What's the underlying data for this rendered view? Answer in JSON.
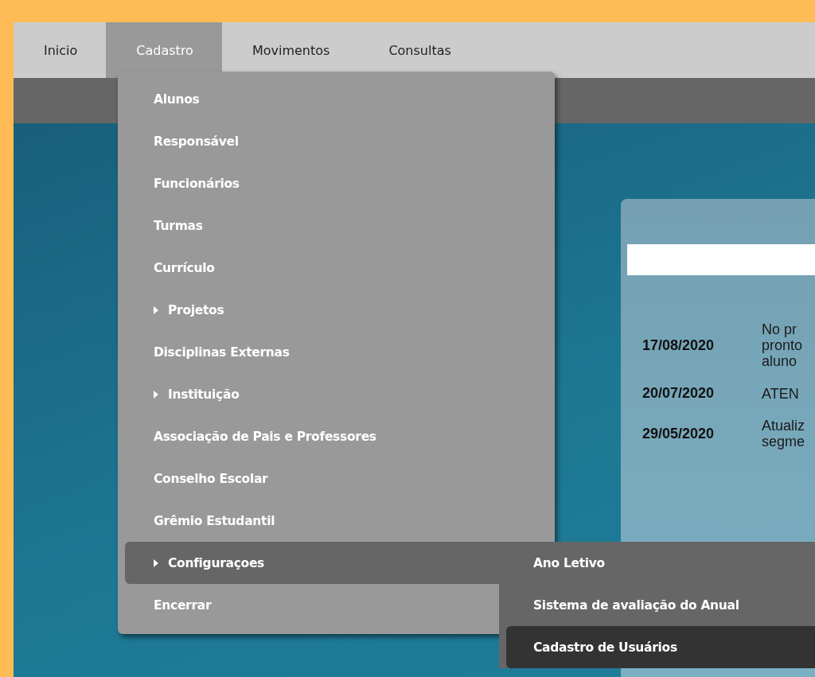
{
  "nav": {
    "tabs": [
      {
        "label": "Inicio",
        "selected": false
      },
      {
        "label": "Cadastro",
        "selected": true
      },
      {
        "label": "Movimentos",
        "selected": false
      },
      {
        "label": "Consultas",
        "selected": false
      }
    ]
  },
  "menu": {
    "items": [
      {
        "label": "Alunos",
        "kind": "item",
        "selected": false
      },
      {
        "label": "Responsável",
        "kind": "item",
        "selected": false
      },
      {
        "label": "Funcionários",
        "kind": "item",
        "selected": false
      },
      {
        "label": "Turmas",
        "kind": "item",
        "selected": false
      },
      {
        "label": "Currículo",
        "kind": "item",
        "selected": false
      },
      {
        "label": "Projetos",
        "kind": "submenu",
        "selected": false
      },
      {
        "label": "Disciplinas Externas",
        "kind": "item",
        "selected": false
      },
      {
        "label": "Instituição",
        "kind": "submenu",
        "selected": false
      },
      {
        "label": "Associação de Pais e Professores",
        "kind": "item",
        "selected": false
      },
      {
        "label": "Conselho Escolar",
        "kind": "item",
        "selected": false
      },
      {
        "label": "Grêmio Estudantil",
        "kind": "item",
        "selected": false
      },
      {
        "label": "Configuraçoes",
        "kind": "submenu",
        "selected": true,
        "children": [
          {
            "label": "Ano Letivo",
            "selected": false
          },
          {
            "label": "Sistema de avaliação do Anual",
            "selected": false
          },
          {
            "label": "Cadastro de Usuários",
            "selected": true
          }
        ]
      },
      {
        "label": "Encerrar",
        "kind": "item",
        "selected": false
      }
    ]
  },
  "news": {
    "rows": [
      {
        "date": "17/08/2020",
        "lines": [
          "No pr",
          "pronto",
          "aluno"
        ]
      },
      {
        "date": "20/07/2020",
        "lines": [
          "ATEN"
        ]
      },
      {
        "date": "29/05/2020",
        "lines": [
          "Atualiz",
          "segme"
        ]
      }
    ]
  }
}
